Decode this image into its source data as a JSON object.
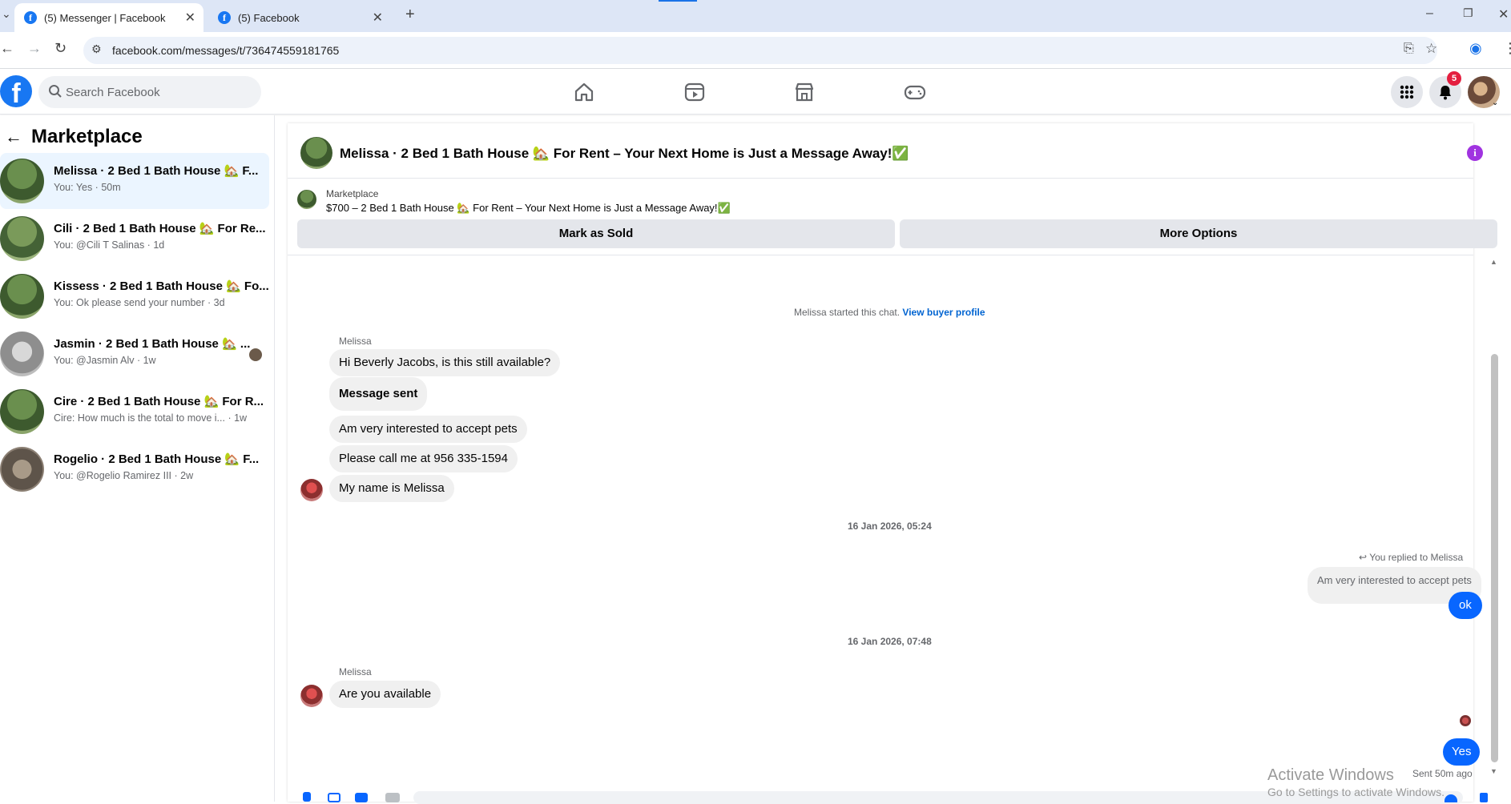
{
  "browser": {
    "tabs": [
      {
        "label": "(5) Messenger | Facebook",
        "active": true
      },
      {
        "label": "(5) Facebook",
        "active": false
      }
    ],
    "new_tab": "+",
    "url": "facebook.com/messages/t/736474559181765",
    "window_controls": [
      "–",
      "❐",
      "✕"
    ]
  },
  "facebook": {
    "logo": "f",
    "search_placeholder": "Search Facebook",
    "nav_icons": [
      "home-icon",
      "video-icon",
      "marketplace-icon",
      "gaming-icon"
    ],
    "notification_count": "5",
    "brand_color": "#1877f2"
  },
  "sidebar": {
    "title": "Marketplace",
    "conversations": [
      {
        "title": "Melissa · 2 Bed 1 Bath House 🏡 F...",
        "preview": "You: Yes · 50m",
        "active": true
      },
      {
        "title": "Cili · 2 Bed 1 Bath House 🏡 For Re...",
        "preview": "You: @Cili T Salinas · 1d",
        "active": false
      },
      {
        "title": "Kissess · 2 Bed 1 Bath House 🏡 Fo...",
        "preview": "You: Ok please send your number · 3d",
        "active": false
      },
      {
        "title": "Jasmin · 2 Bed 1 Bath House 🏡 ...",
        "preview": "You: @Jasmin Alv · 1w",
        "active": false
      },
      {
        "title": "Cire · 2 Bed 1 Bath House 🏡 For R...",
        "preview": "Cire: How much is the total to move i... · 1w",
        "active": false
      },
      {
        "title": "Rogelio · 2 Bed 1 Bath House 🏡 F...",
        "preview": "You: @Rogelio Ramirez III · 2w",
        "active": false
      }
    ]
  },
  "chat": {
    "title": "Melissa · 2 Bed 1 Bath House 🏡 For Rent – Your Next Home is Just a Message Away!✅",
    "listing": {
      "source": "Marketplace",
      "title": "$700 – 2 Bed 1 Bath House 🏡 For Rent – Your Next Home is Just a Message Away!✅",
      "mark_sold": "Mark as Sold",
      "more_options": "More Options"
    },
    "started": "Melissa started this chat.",
    "view_profile": "View buyer profile",
    "sender_name": "Melissa",
    "messages_1": [
      "Hi Beverly Jacobs, is this still available?",
      "Message sent",
      "Am very interested to accept pets",
      "Please call me at 956 335-1594",
      "My name is Melissa"
    ],
    "timestamp_1": "16 Jan 2026, 05:24",
    "replied_label": "You replied to Melissa",
    "replied_quote": "Am very interested to accept pets",
    "reply_ok": "ok",
    "timestamp_2": "16 Jan 2026, 07:48",
    "sender_name_2": "Melissa",
    "message_available": "Are you available",
    "reply_yes": "Yes",
    "sent_status": "Sent 50m ago",
    "outgoing_color": "#0866ff"
  },
  "watermark": {
    "line1": "Activate Windows",
    "line2": "Go to Settings to activate Windows."
  }
}
